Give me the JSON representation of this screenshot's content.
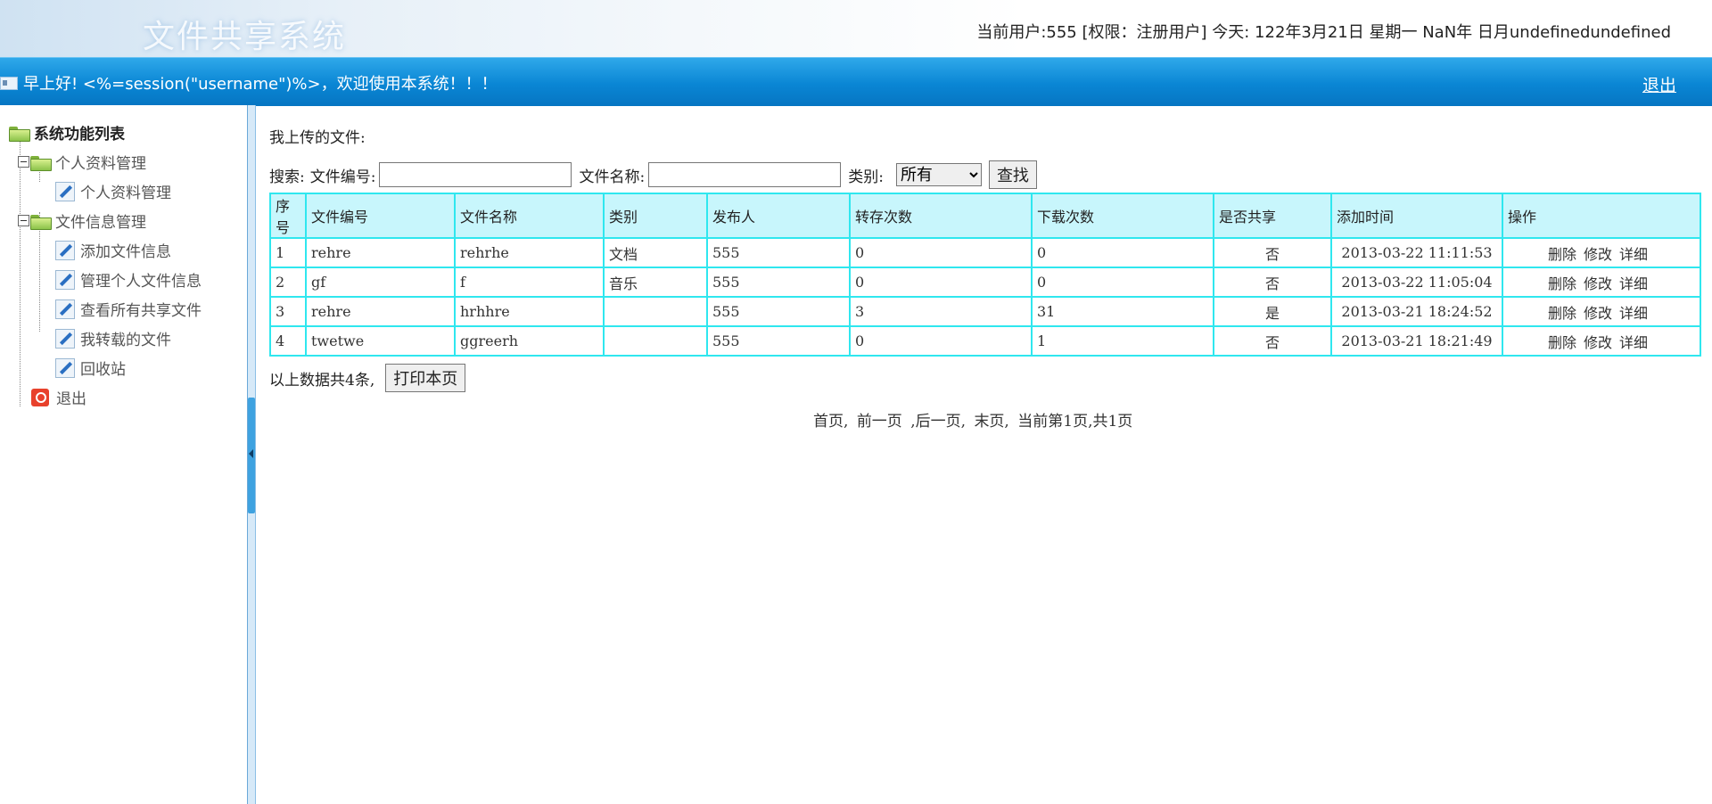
{
  "header": {
    "logo_text": "文件共享系统",
    "user_info": "当前用户:555 [权限：注册用户] 今天:   122年3月21日 星期一 NaN年 日月undefinedundefined"
  },
  "bar": {
    "greeting": "早上好! <%=session(\"username\")%>，欢迎使用本系统！！！",
    "logout": "退出"
  },
  "sidebar": {
    "root": "系统功能列表",
    "group1": "个人资料管理",
    "group1_items": [
      "个人资料管理"
    ],
    "group2": "文件信息管理",
    "group2_items": [
      "添加文件信息",
      "管理个人文件信息",
      "查看所有共享文件",
      "我转载的文件",
      "回收站"
    ],
    "exit": "退出"
  },
  "main": {
    "heading": "我上传的文件:",
    "search_label": "搜索:",
    "file_no_label": "文件编号:",
    "file_name_label": "文件名称:",
    "category_label": "类别:",
    "category_value": "所有",
    "search_button": "查找",
    "columns": [
      "序号",
      "文件编号",
      "文件名称",
      "类别",
      "发布人",
      "转存次数",
      "下载次数",
      "是否共享",
      "添加时间",
      "操作"
    ],
    "rows": [
      {
        "no": "1",
        "code": "rehre",
        "name": "rehrhe",
        "cat": "文档",
        "publisher": "555",
        "transfers": "0",
        "downloads": "0",
        "shared": "否",
        "time": "2013-03-22 11:11:53"
      },
      {
        "no": "2",
        "code": "gf",
        "name": "f",
        "cat": "音乐",
        "publisher": "555",
        "transfers": "0",
        "downloads": "0",
        "shared": "否",
        "time": "2013-03-22 11:05:04"
      },
      {
        "no": "3",
        "code": "rehre",
        "name": "hrhhre",
        "cat": "",
        "publisher": "555",
        "transfers": "3",
        "downloads": "31",
        "shared": "是",
        "time": "2013-03-21 18:24:52"
      },
      {
        "no": "4",
        "code": "twetwe",
        "name": "ggreerh",
        "cat": "",
        "publisher": "555",
        "transfers": "0",
        "downloads": "1",
        "shared": "否",
        "time": "2013-03-21 18:21:49"
      }
    ],
    "ops": [
      "删除",
      "修改",
      "详细"
    ],
    "total_text": "以上数据共4条,",
    "print_button": "打印本页",
    "pager": {
      "first": "首页,",
      "prev": "前一页",
      "next": ",后一页,",
      "last": "末页,",
      "status": "当前第1页,共1页"
    }
  },
  "colors": {
    "bar": "#0a86d4",
    "table_border": "#2fe7ef",
    "table_header": "#c8f6fc"
  }
}
